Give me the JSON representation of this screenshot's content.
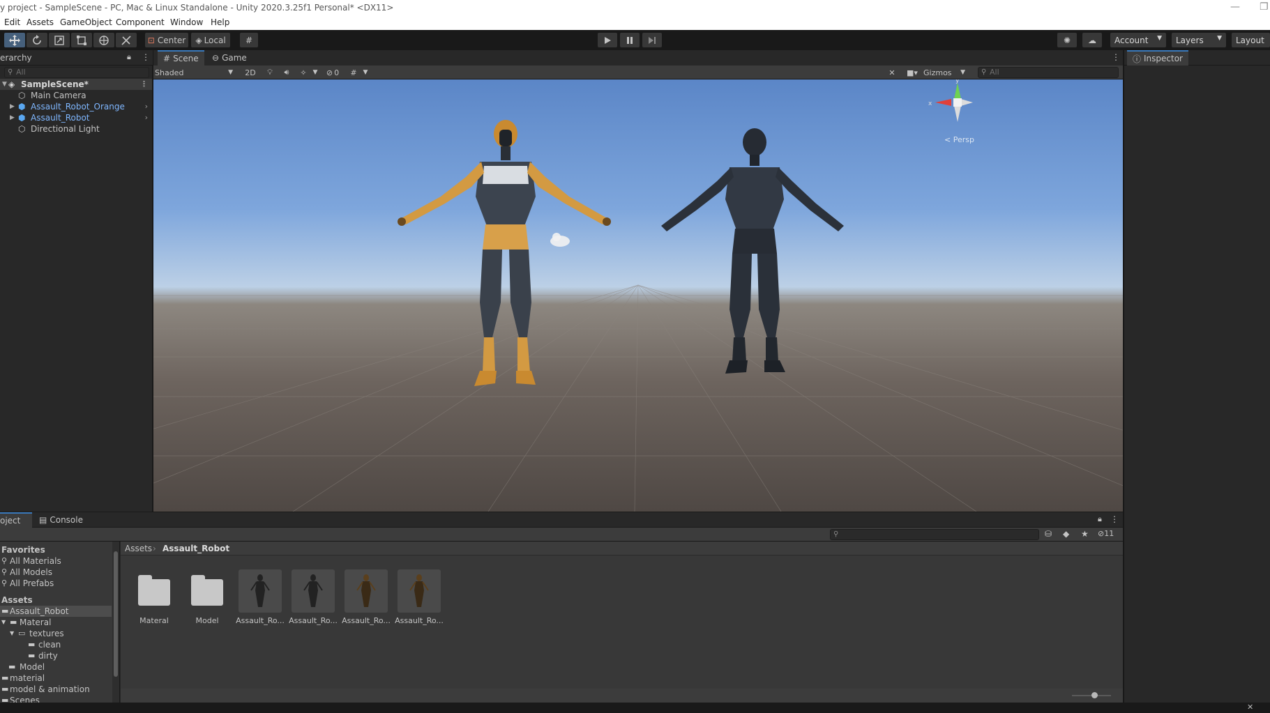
{
  "window": {
    "title": "y project - SampleScene - PC, Mac & Linux Standalone - Unity 2020.3.25f1 Personal* <DX11>",
    "minimize": "—",
    "restore": "❐"
  },
  "menu": [
    "Edit",
    "Assets",
    "GameObject",
    "Component",
    "Window",
    "Help"
  ],
  "toolbar": {
    "tools": [
      "move-tool",
      "rotate-tool",
      "scale-tool",
      "rect-tool",
      "transform-tool",
      "custom-tool"
    ],
    "pivot_label": "Center",
    "space_label": "Local",
    "account_label": "Account",
    "layers_label": "Layers",
    "layout_label": "Layout"
  },
  "hierarchy": {
    "tab_label": "erarchy",
    "search_placeholder": "All",
    "scene": "SampleScene*",
    "items": [
      {
        "label": "Main Camera",
        "prefab": false
      },
      {
        "label": "Assault_Robot_Orange",
        "prefab": true
      },
      {
        "label": "Assault_Robot",
        "prefab": true
      },
      {
        "label": "Directional Light",
        "prefab": false
      }
    ]
  },
  "scene": {
    "tabs": [
      "Scene",
      "Game"
    ],
    "shading_mode": "Shaded",
    "mode_2d": "2D",
    "hidden_count": "0",
    "gizmos_label": "Gizmos",
    "search_placeholder": "All",
    "projection_label": "< Persp",
    "axis_x": "x",
    "axis_y": "y"
  },
  "inspector": {
    "tab_label": "Inspector"
  },
  "project": {
    "tabs": [
      "oject",
      "Console"
    ],
    "hidden_count": "11",
    "favorites_header": "Favorites",
    "favorites": [
      "All Materials",
      "All Models",
      "All Prefabs"
    ],
    "assets_header": "Assets",
    "tree": [
      {
        "label": "Assault_Robot",
        "depth": 0,
        "selected": true
      },
      {
        "label": "Materal",
        "depth": 1,
        "selected": false
      },
      {
        "label": "textures",
        "depth": 2,
        "selected": false
      },
      {
        "label": "clean",
        "depth": 3,
        "selected": false
      },
      {
        "label": "dirty",
        "depth": 3,
        "selected": false
      },
      {
        "label": "Model",
        "depth": 1,
        "selected": false
      },
      {
        "label": "material",
        "depth": 0,
        "selected": false
      },
      {
        "label": "model & animation",
        "depth": 0,
        "selected": false
      },
      {
        "label": "Scenes",
        "depth": 0,
        "selected": false
      }
    ],
    "breadcrumb": [
      "Assets",
      "Assault_Robot"
    ],
    "assets": [
      {
        "label": "Materal",
        "kind": "folder"
      },
      {
        "label": "Model",
        "kind": "folder"
      },
      {
        "label": "Assault_Ro...",
        "kind": "prefab"
      },
      {
        "label": "Assault_Ro...",
        "kind": "prefab"
      },
      {
        "label": "Assault_Ro...",
        "kind": "prefab"
      },
      {
        "label": "Assault_Ro...",
        "kind": "prefab"
      }
    ]
  },
  "colors": {
    "accent": "#3a79bb",
    "panel": "#282828",
    "prefab_text": "#7fb7ff",
    "robot_orange": "#d89a3a",
    "robot_dark": "#2e3440"
  }
}
